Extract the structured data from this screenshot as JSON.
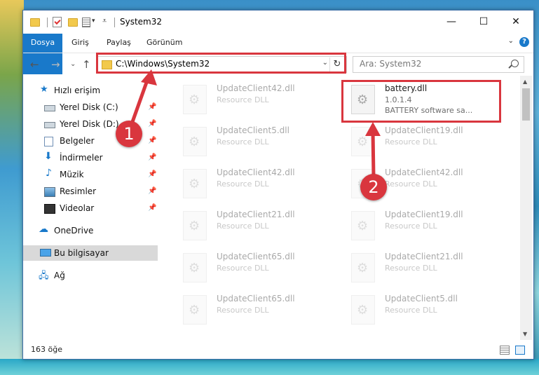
{
  "window": {
    "title": "System32",
    "ribbon_tabs": [
      "Dosya",
      "Giriş",
      "Paylaş",
      "Görünüm"
    ],
    "help_label": "?"
  },
  "address_bar": {
    "path": "C:\\Windows\\System32",
    "search_placeholder": "Ara: System32"
  },
  "sidebar": {
    "items": [
      {
        "label": "Hızlı erişim",
        "icon": "star-icon"
      },
      {
        "label": "Yerel Disk (C:)",
        "icon": "drive-icon"
      },
      {
        "label": "Yerel Disk (D:)",
        "icon": "drive-icon"
      },
      {
        "label": "Belgeler",
        "icon": "documents-icon"
      },
      {
        "label": "İndirmeler",
        "icon": "download-icon"
      },
      {
        "label": "Müzik",
        "icon": "music-icon"
      },
      {
        "label": "Resimler",
        "icon": "pictures-icon"
      },
      {
        "label": "Videolar",
        "icon": "videos-icon"
      },
      {
        "label": "OneDrive",
        "icon": "cloud-icon"
      },
      {
        "label": "Bu bilgisayar",
        "icon": "computer-icon"
      },
      {
        "label": "Ağ",
        "icon": "network-icon"
      }
    ]
  },
  "files": {
    "left": [
      {
        "name": "UpdateClient42.dll",
        "type": "Resource DLL"
      },
      {
        "name": "UpdateClient5.dll",
        "type": "Resource DLL"
      },
      {
        "name": "UpdateClient42.dll",
        "type": "Resource DLL"
      },
      {
        "name": "UpdateClient21.dll",
        "type": "Resource DLL"
      },
      {
        "name": "UpdateClient65.dll",
        "type": "Resource DLL"
      },
      {
        "name": "UpdateClient65.dll",
        "type": "Resource DLL"
      }
    ],
    "right": [
      {
        "name": "battery.dll",
        "version": "1.0.1.4",
        "description": "BATTERY software sa..."
      },
      {
        "name": "UpdateClient19.dll",
        "type": "Resource DLL"
      },
      {
        "name": "UpdateClient42.dll",
        "type": "Resource DLL"
      },
      {
        "name": "UpdateClient19.dll",
        "type": "Resource DLL"
      },
      {
        "name": "UpdateClient21.dll",
        "type": "Resource DLL"
      },
      {
        "name": "UpdateClient5.dll",
        "type": "Resource DLL"
      }
    ]
  },
  "status": {
    "item_count": "163 öğe"
  },
  "annotations": {
    "step1": "1",
    "step2": "2",
    "highlight_color": "#d9363e"
  },
  "colors": {
    "accent": "#1979ca"
  }
}
